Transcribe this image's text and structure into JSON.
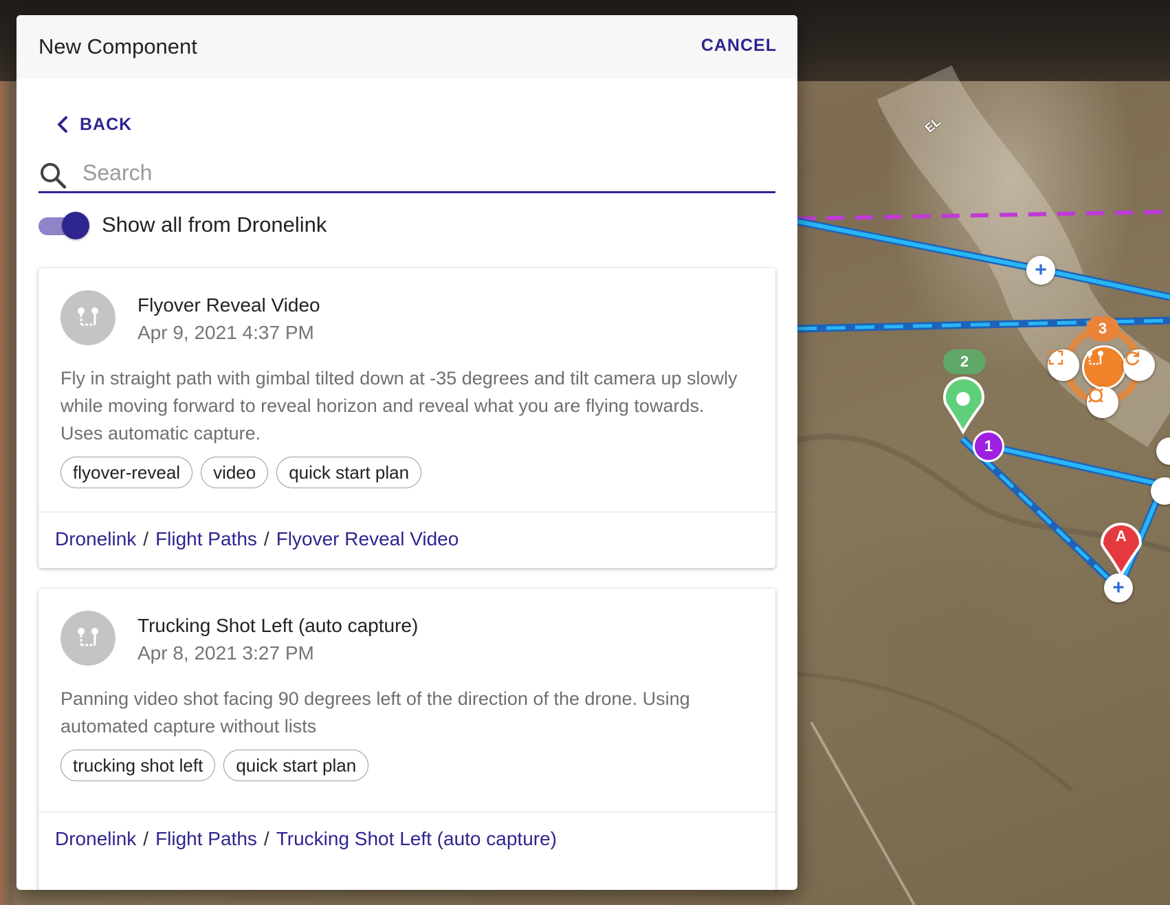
{
  "dialog": {
    "title": "New Component",
    "cancel_label": "CANCEL",
    "back_label": "BACK",
    "search": {
      "placeholder": "Search",
      "value": ""
    },
    "toggle": {
      "label": "Show all from Dronelink",
      "on": true
    }
  },
  "cards": [
    {
      "title": "Flyover Reveal Video",
      "date": "Apr 9, 2021 4:37 PM",
      "description": "Fly in straight path with gimbal tilted down at -35 degrees and tilt camera up slowly while moving forward to reveal horizon and reveal what you are flying towards. Uses automatic capture.",
      "tags": [
        "flyover-reveal",
        "video",
        "quick start plan"
      ],
      "breadcrumb": [
        "Dronelink",
        "Flight Paths",
        "Flyover Reveal Video"
      ],
      "separator": "/"
    },
    {
      "title": "Trucking Shot Left (auto capture)",
      "date": "Apr 8, 2021 3:27 PM",
      "description": "Panning video shot facing 90 degrees left of the direction of the drone. Using automated capture without lists",
      "tags": [
        "trucking shot left",
        "quick start plan"
      ],
      "breadcrumb": [
        "Dronelink",
        "Flight Paths",
        "Trucking Shot Left (auto capture)"
      ],
      "separator": "/"
    }
  ],
  "map": {
    "markers": {
      "waypoint_1": "1",
      "waypoint_2": "2",
      "waypoint_3": "3",
      "origin": "A",
      "compass": "EL"
    },
    "colors": {
      "path": "#29b6f6",
      "path_dark": "#1e63b8",
      "boundary": "#c03ad6",
      "orange": "#f0832a",
      "green": "#5fcf7a",
      "purple": "#a020e0",
      "red": "#e53940",
      "accent": "#2e2590"
    }
  }
}
